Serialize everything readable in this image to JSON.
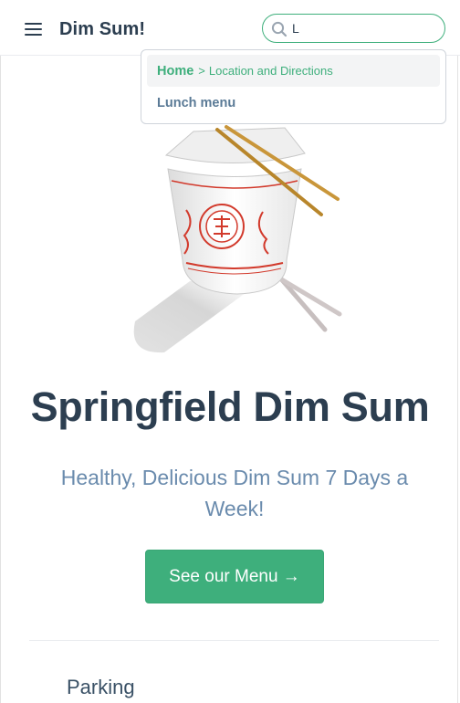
{
  "navbar": {
    "site_title": "Dim Sum!",
    "search_value": "L"
  },
  "search_suggestions": [
    {
      "page": "Home",
      "separator": ">",
      "header": "Location and Directions",
      "focused": true
    },
    {
      "page": "Lunch menu",
      "focused": false
    }
  ],
  "hero": {
    "title": "Springfield Dim Sum",
    "description": "Healthy, Delicious Dim Sum 7 Days a Week!",
    "action_label": "See our Menu →"
  },
  "features": [
    {
      "title": "Parking"
    }
  ],
  "colors": {
    "accent": "#3eaf7c",
    "text": "#2c3e50",
    "muted": "#6a8bad"
  },
  "icons": {
    "menu": "hamburger-icon",
    "search": "search-icon",
    "hero": "takeout-box-illustration"
  }
}
